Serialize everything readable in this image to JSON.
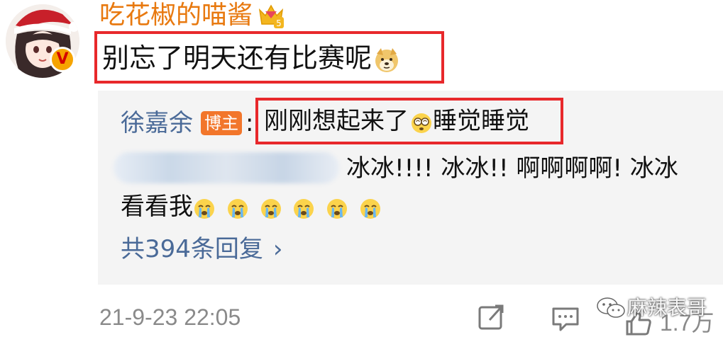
{
  "comment": {
    "username": "吃花椒的喵酱",
    "text": "别忘了明天还有比赛呢",
    "verified_badge": "V",
    "level": "5"
  },
  "reply": {
    "author": "徐嘉余",
    "author_badge": "博主",
    "separator": ":",
    "text": "刚刚想起来了",
    "text_after_emoji": "睡觉睡觉"
  },
  "sub_reply": {
    "line1": "冰冰!!!! 冰冰!! 啊啊啊啊! 冰冰",
    "line2": "看看我"
  },
  "more_replies": {
    "label": "共394条回复",
    "chevron": "›"
  },
  "footer": {
    "timestamp": "21-9-23 22:05",
    "like_count": "1.7万",
    "watermark": "麻辣表哥"
  },
  "colors": {
    "username": "#e8790f",
    "highlight_border": "#e8282b",
    "link_blue": "#4a6a98",
    "blogger_badge": "#f2762b",
    "reply_bg": "#f4f4f4"
  },
  "icons": [
    "avatar",
    "verified-v-icon",
    "crown-level-icon",
    "doge-emoji-icon",
    "dizzy-emoji-icon",
    "crying-emoji-icon",
    "chevron-right-icon",
    "share-icon",
    "comment-icon",
    "wechat-icon",
    "like-icon"
  ]
}
